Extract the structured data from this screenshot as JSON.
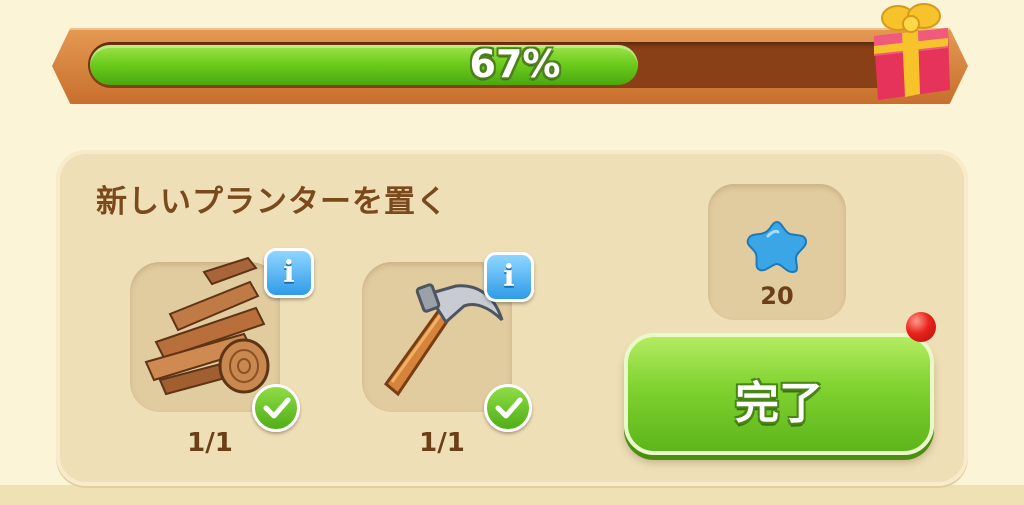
{
  "progress": {
    "label": "67%",
    "value": 0.67
  },
  "task": {
    "title": "新しいプランターを置く",
    "items": [
      {
        "name": "wood-planks",
        "count": "1/1",
        "completed": true
      },
      {
        "name": "hammer",
        "count": "1/1",
        "completed": true
      }
    ]
  },
  "reward": {
    "icon": "blue-star-gem-icon",
    "amount": "20"
  },
  "complete_button": {
    "label": "完了"
  },
  "colors": {
    "accent_green": "#6fcd1e",
    "panel": "#efdfb7",
    "text_brown": "#7a4a1e",
    "info_blue": "#2f9be8"
  }
}
